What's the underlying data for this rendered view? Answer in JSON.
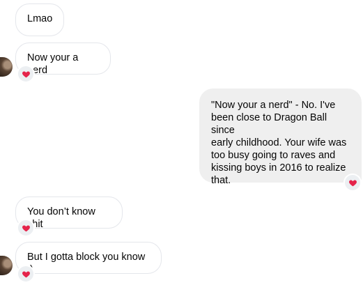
{
  "messages": [
    {
      "side": "received",
      "text": "Lmao",
      "reaction": "heart-icon"
    },
    {
      "side": "received",
      "text": "Now your a nerd",
      "reaction": "heart-icon"
    },
    {
      "side": "sent",
      "lines": [
        "\"Now your a nerd\" - No. I've",
        "been close to Dragon Ball since",
        "early childhood. Your wife was",
        "too busy going to raves and",
        "kissing boys in 2016 to realize",
        "that."
      ],
      "reaction": "heart-icon"
    },
    {
      "side": "received",
      "text": "You don’t know shit",
      "reaction": "heart-icon"
    },
    {
      "side": "received",
      "text": "But I gotta block you know :)",
      "reaction": "heart-icon"
    }
  ],
  "colors": {
    "heart": "#e5244b",
    "sent_bubble": "#efefef",
    "received_border": "#e4e6eb"
  }
}
